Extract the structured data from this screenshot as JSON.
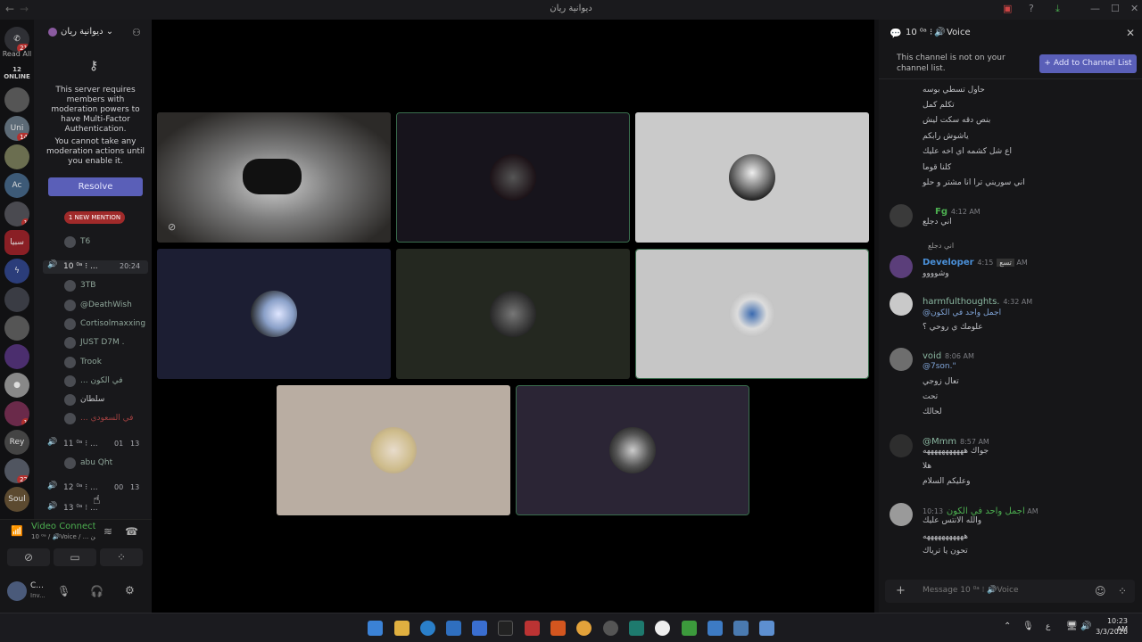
{
  "window": {
    "title": "ديوانية ريان",
    "nav_back": "←",
    "nav_forward": "→"
  },
  "rail": {
    "read_all": "Read All",
    "online": "12 ONLINE",
    "badges": [
      "21",
      "14",
      "1",
      "1",
      "1",
      "22"
    ],
    "labels": [
      "Uni",
      "Ac",
      "sp",
      "سبيا",
      "Rey",
      "Soul"
    ]
  },
  "server": {
    "name": "ديوانية ريان"
  },
  "mfa_notice": {
    "line1": "This server requires members with moderation powers to have Multi-Factor Authentication.",
    "line2": "You cannot take any moderation actions until you enable it.",
    "resolve": "Resolve"
  },
  "new_mention": "1 NEW MENTION",
  "channels": {
    "pre_user": "T6",
    "ch10": {
      "name": "10 ⁰ᵃ ⁝ ...",
      "time": "20:24"
    },
    "ch10_users": [
      "3TB",
      "@DeathWish",
      "Cortisolmaxxing",
      "JUST D7M .",
      "Trook",
      "... في الكون",
      "سلطان",
      "... في السعودي"
    ],
    "ch11": {
      "name": "11 ⁰ᵃ ⁝ ...",
      "a": "01",
      "b": "13"
    },
    "ch11_users": [
      "abu Qht"
    ],
    "ch12": {
      "name": "12 ⁰ᵃ ⁝ ...",
      "a": "00",
      "b": "13"
    },
    "ch13": {
      "name": "13 ⁰ᵃ ⁝ ..."
    }
  },
  "voice_panel": {
    "status": "Video Connected",
    "sub": "10 ⁰ᵃ / 🔊Voice / ... بن"
  },
  "user_panel": {
    "name": "C...",
    "status": "Inv..."
  },
  "right": {
    "channel": "10 ⁰ᵃ ⁝",
    "voice": "Voice",
    "notice": "This channel is not on your channel list.",
    "add_btn": "+ Add to Channel List",
    "composer_placeholder": "Message 10 ⁰ᵃ ⁝ 🔊Voice"
  },
  "messages": {
    "top_lines": [
      "حاول تسطي بوسه",
      "تكلم كمل",
      "بنص دقه سكت ليش",
      "ياشوش رابكم",
      "اع شل كشمه اي اخه عليك",
      "كلنا قوما",
      "اني سوريني ترا انا مشتر و حلو"
    ],
    "m1": {
      "user": "Fg",
      "time": "4:12 AM",
      "lines": [
        "اني دجلع"
      ]
    },
    "m2": {
      "reply": "اني دجلع",
      "user": "Developer",
      "tag": "تسع",
      "time": "4:15 AM",
      "lines": [
        "وشوووو"
      ]
    },
    "m3": {
      "user": "harmfulthoughts.",
      "time": "4:32 AM",
      "lines": [
        "@اجمل واحد في الكون",
        "علومك ي روحي ؟"
      ]
    },
    "m4": {
      "user": "void",
      "time": "8:06 AM",
      "lines": [
        "@7son.\"",
        "تعال زوجي",
        "تحت",
        "لحالك"
      ]
    },
    "m5": {
      "user": "@Mmm",
      "time": "8:57 AM",
      "lines": [
        "جواك هههههههههههه",
        "هلا",
        "وعليكم السلام"
      ]
    },
    "m6": {
      "user": "اجمل واحد في الكون",
      "time": "10:13 AM",
      "lines": [
        "والله الانتس عليك",
        "هههههههههههه",
        "تحون يا ترياك"
      ]
    }
  },
  "taskbar": {
    "time": "10:23 AM",
    "date": "3/3/2026",
    "lang": "ع"
  }
}
